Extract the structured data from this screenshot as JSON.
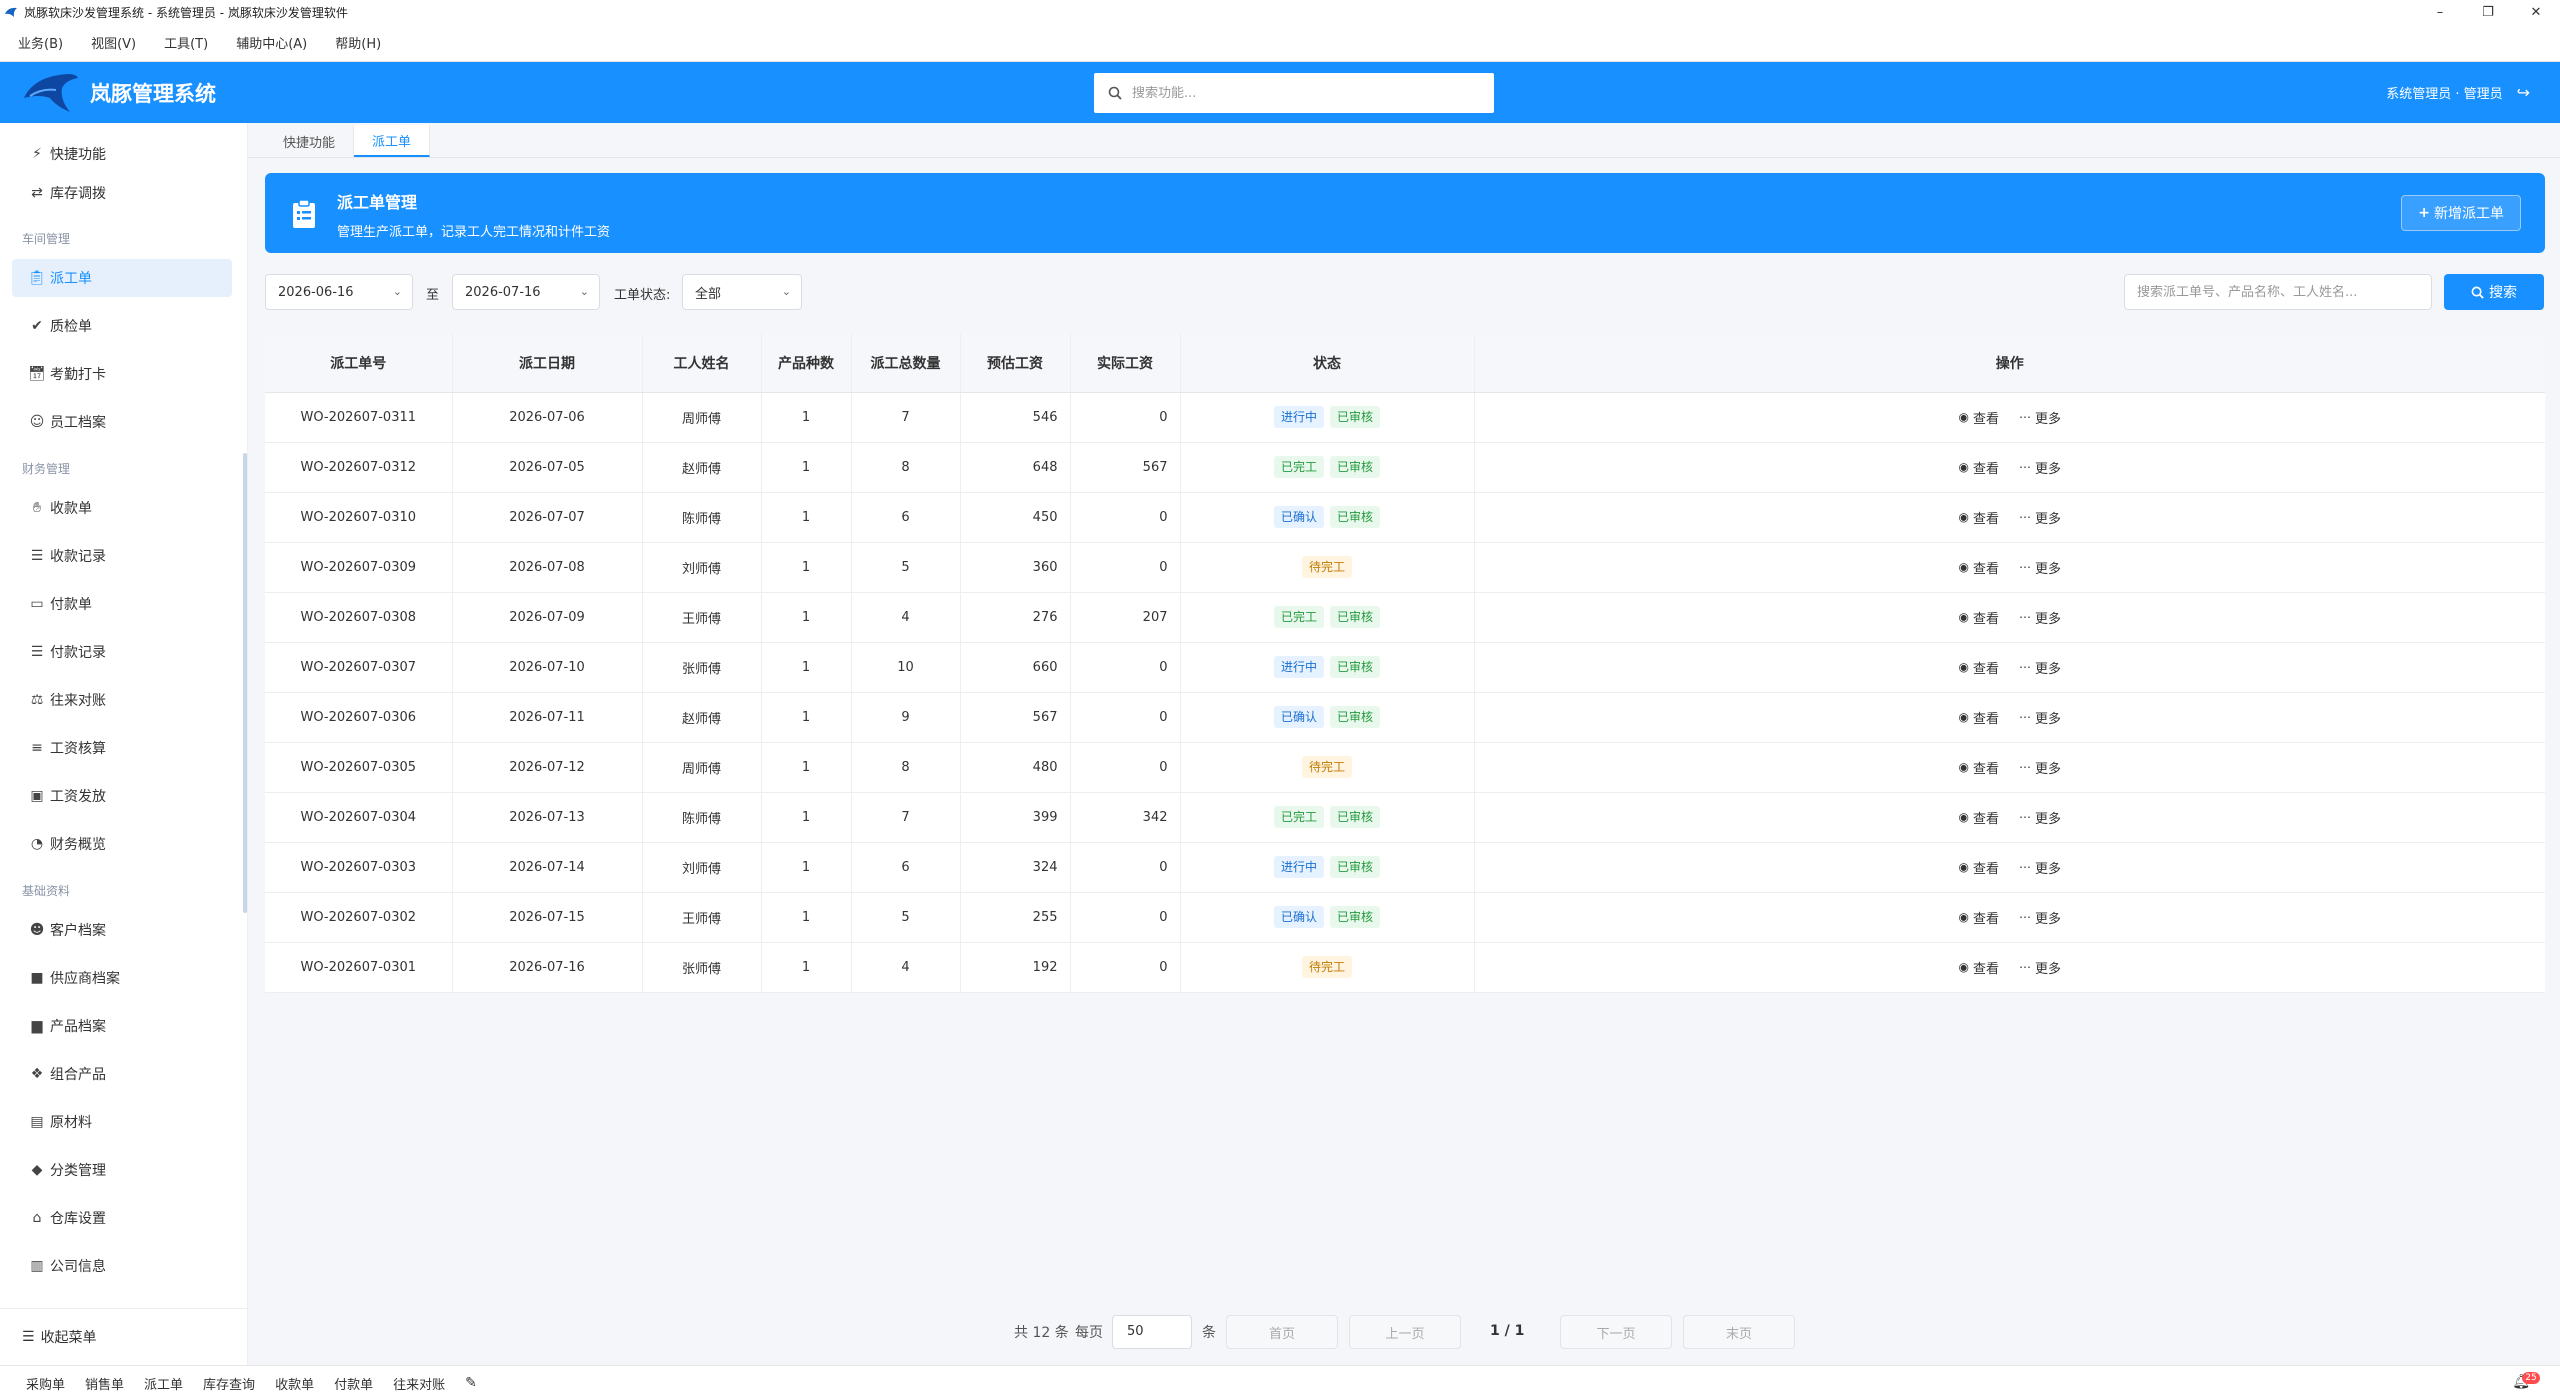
{
  "window": {
    "title": "岚豚软床沙发管理系统 - 系统管理员 - 岚豚软床沙发管理软件"
  },
  "menubar": [
    "业务(B)",
    "视图(V)",
    "工具(T)",
    "辅助中心(A)",
    "帮助(H)"
  ],
  "header": {
    "brand": "岚豚管理系统",
    "search_placeholder": "搜索功能...",
    "user": "系统管理员 · 管理员"
  },
  "sidebar": {
    "quick": [
      {
        "label": "快捷功能",
        "icon": "bolt-icon"
      },
      {
        "label": "库存调拨",
        "icon": "transfer-icon"
      }
    ],
    "sections": [
      {
        "title": "车间管理",
        "items": [
          {
            "label": "派工单",
            "icon": "clipboard-icon",
            "active": true
          },
          {
            "label": "质检单",
            "icon": "check-circle-icon"
          },
          {
            "label": "考勤打卡",
            "icon": "calendar-check-icon"
          },
          {
            "label": "员工档案",
            "icon": "user-icon"
          }
        ]
      },
      {
        "title": "财务管理",
        "items": [
          {
            "label": "收款单",
            "icon": "hand-coin-icon"
          },
          {
            "label": "收款记录",
            "icon": "list-icon"
          },
          {
            "label": "付款单",
            "icon": "card-icon"
          },
          {
            "label": "付款记录",
            "icon": "list-icon"
          },
          {
            "label": "往来对账",
            "icon": "scale-icon"
          },
          {
            "label": "工资核算",
            "icon": "coins-icon"
          },
          {
            "label": "工资发放",
            "icon": "money-icon"
          },
          {
            "label": "财务概览",
            "icon": "pie-chart-icon"
          }
        ]
      },
      {
        "title": "基础资料",
        "items": [
          {
            "label": "客户档案",
            "icon": "users-icon"
          },
          {
            "label": "供应商档案",
            "icon": "truck-icon"
          },
          {
            "label": "产品档案",
            "icon": "couch-icon"
          },
          {
            "label": "组合产品",
            "icon": "cubes-icon"
          },
          {
            "label": "原材料",
            "icon": "box-icon"
          },
          {
            "label": "分类管理",
            "icon": "tags-icon"
          },
          {
            "label": "仓库设置",
            "icon": "warehouse-icon"
          },
          {
            "label": "公司信息",
            "icon": "building-icon"
          }
        ]
      }
    ],
    "collapse_label": "收起菜单"
  },
  "tabs": [
    {
      "label": "快捷功能",
      "active": false
    },
    {
      "label": "派工单",
      "active": true
    }
  ],
  "banner": {
    "title": "派工单管理",
    "subtitle": "管理生产派工单，记录工人完工情况和计件工资",
    "new_button": "新增派工单"
  },
  "filters": {
    "date_from": "2026-06-16",
    "date_sep": "至",
    "date_to": "2026-07-16",
    "status_label": "工单状态:",
    "status_value": "全部",
    "search_placeholder": "搜索派工单号、产品名称、工人姓名...",
    "search_button": "搜索"
  },
  "table": {
    "columns": [
      "派工单号",
      "派工日期",
      "工人姓名",
      "产品种数",
      "派工总数量",
      "预估工资",
      "实际工资",
      "状态",
      "操作"
    ],
    "view_label": "查看",
    "more_label": "更多",
    "rows": [
      {
        "id": "WO-202607-0311",
        "date": "2026-07-06",
        "worker": "周师傅",
        "kinds": "1",
        "qty": "7",
        "est": "546",
        "actual": "0",
        "badges": [
          {
            "text": "进行中",
            "color": "blue"
          },
          {
            "text": "已审核",
            "color": "green"
          }
        ]
      },
      {
        "id": "WO-202607-0312",
        "date": "2026-07-05",
        "worker": "赵师傅",
        "kinds": "1",
        "qty": "8",
        "est": "648",
        "actual": "567",
        "badges": [
          {
            "text": "已完工",
            "color": "green"
          },
          {
            "text": "已审核",
            "color": "green"
          }
        ]
      },
      {
        "id": "WO-202607-0310",
        "date": "2026-07-07",
        "worker": "陈师傅",
        "kinds": "1",
        "qty": "6",
        "est": "450",
        "actual": "0",
        "badges": [
          {
            "text": "已确认",
            "color": "blue"
          },
          {
            "text": "已审核",
            "color": "green"
          }
        ]
      },
      {
        "id": "WO-202607-0309",
        "date": "2026-07-08",
        "worker": "刘师傅",
        "kinds": "1",
        "qty": "5",
        "est": "360",
        "actual": "0",
        "badges": [
          {
            "text": "待完工",
            "color": "orange"
          }
        ]
      },
      {
        "id": "WO-202607-0308",
        "date": "2026-07-09",
        "worker": "王师傅",
        "kinds": "1",
        "qty": "4",
        "est": "276",
        "actual": "207",
        "badges": [
          {
            "text": "已完工",
            "color": "green"
          },
          {
            "text": "已审核",
            "color": "green"
          }
        ]
      },
      {
        "id": "WO-202607-0307",
        "date": "2026-07-10",
        "worker": "张师傅",
        "kinds": "1",
        "qty": "10",
        "est": "660",
        "actual": "0",
        "badges": [
          {
            "text": "进行中",
            "color": "blue"
          },
          {
            "text": "已审核",
            "color": "green"
          }
        ]
      },
      {
        "id": "WO-202607-0306",
        "date": "2026-07-11",
        "worker": "赵师傅",
        "kinds": "1",
        "qty": "9",
        "est": "567",
        "actual": "0",
        "badges": [
          {
            "text": "已确认",
            "color": "blue"
          },
          {
            "text": "已审核",
            "color": "green"
          }
        ]
      },
      {
        "id": "WO-202607-0305",
        "date": "2026-07-12",
        "worker": "周师傅",
        "kinds": "1",
        "qty": "8",
        "est": "480",
        "actual": "0",
        "badges": [
          {
            "text": "待完工",
            "color": "orange"
          }
        ]
      },
      {
        "id": "WO-202607-0304",
        "date": "2026-07-13",
        "worker": "陈师傅",
        "kinds": "1",
        "qty": "7",
        "est": "399",
        "actual": "342",
        "badges": [
          {
            "text": "已完工",
            "color": "green"
          },
          {
            "text": "已审核",
            "color": "green"
          }
        ]
      },
      {
        "id": "WO-202607-0303",
        "date": "2026-07-14",
        "worker": "刘师傅",
        "kinds": "1",
        "qty": "6",
        "est": "324",
        "actual": "0",
        "badges": [
          {
            "text": "进行中",
            "color": "blue"
          },
          {
            "text": "已审核",
            "color": "green"
          }
        ]
      },
      {
        "id": "WO-202607-0302",
        "date": "2026-07-15",
        "worker": "王师傅",
        "kinds": "1",
        "qty": "5",
        "est": "255",
        "actual": "0",
        "badges": [
          {
            "text": "已确认",
            "color": "blue"
          },
          {
            "text": "已审核",
            "color": "green"
          }
        ]
      },
      {
        "id": "WO-202607-0301",
        "date": "2026-07-16",
        "worker": "张师傅",
        "kinds": "1",
        "qty": "4",
        "est": "192",
        "actual": "0",
        "badges": [
          {
            "text": "待完工",
            "color": "orange"
          }
        ]
      }
    ]
  },
  "pagination": {
    "total": "共 12 条",
    "per_page_label": "每页",
    "per_page": "50",
    "unit": "条",
    "first": "首页",
    "prev": "上一页",
    "page": "1 / 1",
    "next": "下一页",
    "last": "末页"
  },
  "footer": {
    "items": [
      "采购单",
      "销售单",
      "派工单",
      "库存查询",
      "收款单",
      "付款单",
      "往来对账"
    ],
    "notification_count": "25"
  },
  "colors": {
    "primary": "#1890ff",
    "active_bg": "#e6f0fc",
    "badge_blue": "#1870d0",
    "badge_green": "#239a3e",
    "badge_orange": "#c27a00"
  }
}
